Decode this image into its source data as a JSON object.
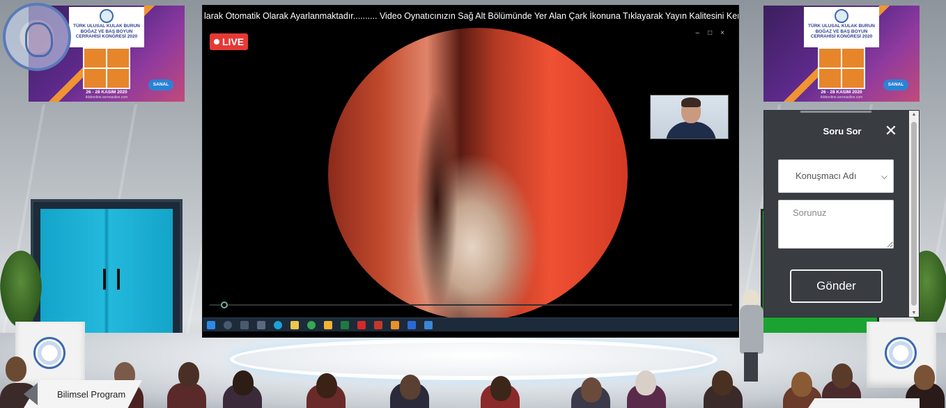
{
  "marquee": {
    "text": "larak Otomatik Olarak Ayarlanmaktadır.......... Video Oynatıcınızın Sağ Alt Bölümünde Yer Alan Çark İkonuna Tıklayarak Yayın Kalitesini Kendiniz Belirley"
  },
  "video": {
    "live_label": "LIVE",
    "colors": {
      "live": "#e53935"
    }
  },
  "poster": {
    "title": "TÜRK ULUSAL KULAK BURUN BOĞAZ VE BAŞ BOYUN CERRAHİSİ KONGRESİ 2020",
    "dates": "26 - 28 KASIM 2020",
    "url": "tkbbonline.serenaslive.com",
    "badge": "SANAL"
  },
  "seal": {
    "text": "TÜRK KULAK BURUN BOĞAZ BAŞ BOYUN CERRAHİSİ DERNEĞİ"
  },
  "ask_panel": {
    "title": "Soru Sor",
    "close_icon": "close-icon",
    "speaker_select": {
      "selected": "Konuşmacı Adı"
    },
    "question": {
      "placeholder": "Sorunuz",
      "value": ""
    },
    "send_label": "Gönder"
  },
  "nav": {
    "program_label": "Bilimsel Program"
  },
  "icons": {
    "volume": "speaker-icon",
    "subtitles": "subtitles-icon",
    "pencil": "pencil-icon",
    "fullscreen": "fullscreen-icon",
    "more": "more-icon"
  }
}
